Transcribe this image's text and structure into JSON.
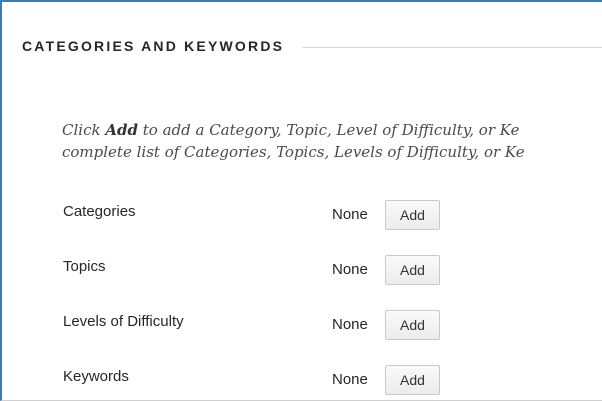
{
  "section": {
    "title": "CATEGORIES AND KEYWORDS"
  },
  "instructions": {
    "line1_prefix": "Click ",
    "line1_bold": "Add",
    "line1_suffix": " to add a Category, Topic, Level of Difficulty, or Ke",
    "line2": "complete list of Categories, Topics, Levels of Difficulty, or Ke"
  },
  "rows": [
    {
      "label": "Categories",
      "value": "None",
      "button": "Add"
    },
    {
      "label": "Topics",
      "value": "None",
      "button": "Add"
    },
    {
      "label": "Levels of Difficulty",
      "value": "None",
      "button": "Add"
    },
    {
      "label": "Keywords",
      "value": "None",
      "button": "Add"
    }
  ],
  "colors": {
    "frame_border": "#2f7fc1",
    "text": "#262626",
    "button_border": "#c9c9c9"
  }
}
